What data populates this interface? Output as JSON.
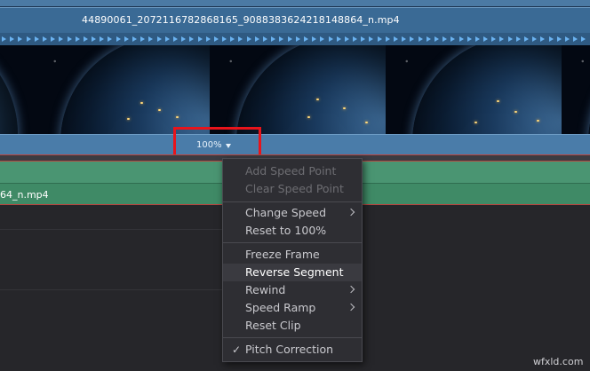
{
  "timeline": {
    "video_clip_name": "44890061_2072116782868165_9088383624218148864_n.mp4",
    "audio_clip_name": "64_n.mp4",
    "speed_value": "100%"
  },
  "context_menu": {
    "items": [
      {
        "label": "Add Speed Point",
        "enabled": false
      },
      {
        "label": "Clear Speed Point",
        "enabled": false
      },
      {
        "label": "Change Speed",
        "enabled": true,
        "submenu": true
      },
      {
        "label": "Reset to 100%",
        "enabled": true
      },
      {
        "label": "Freeze Frame",
        "enabled": true
      },
      {
        "label": "Reverse Segment",
        "enabled": true,
        "hovered": true
      },
      {
        "label": "Rewind",
        "enabled": true,
        "submenu": true
      },
      {
        "label": "Speed Ramp",
        "enabled": true,
        "submenu": true
      },
      {
        "label": "Reset Clip",
        "enabled": true
      },
      {
        "label": "Pitch Correction",
        "enabled": true,
        "checked": true
      }
    ],
    "check_glyph": "✓"
  },
  "watermark": "wfxld.com",
  "colors": {
    "video_track": "#3d6f9b",
    "audio_track": "#3f8a66",
    "highlight": "#e8141b",
    "menu_bg": "#2e2e33"
  }
}
